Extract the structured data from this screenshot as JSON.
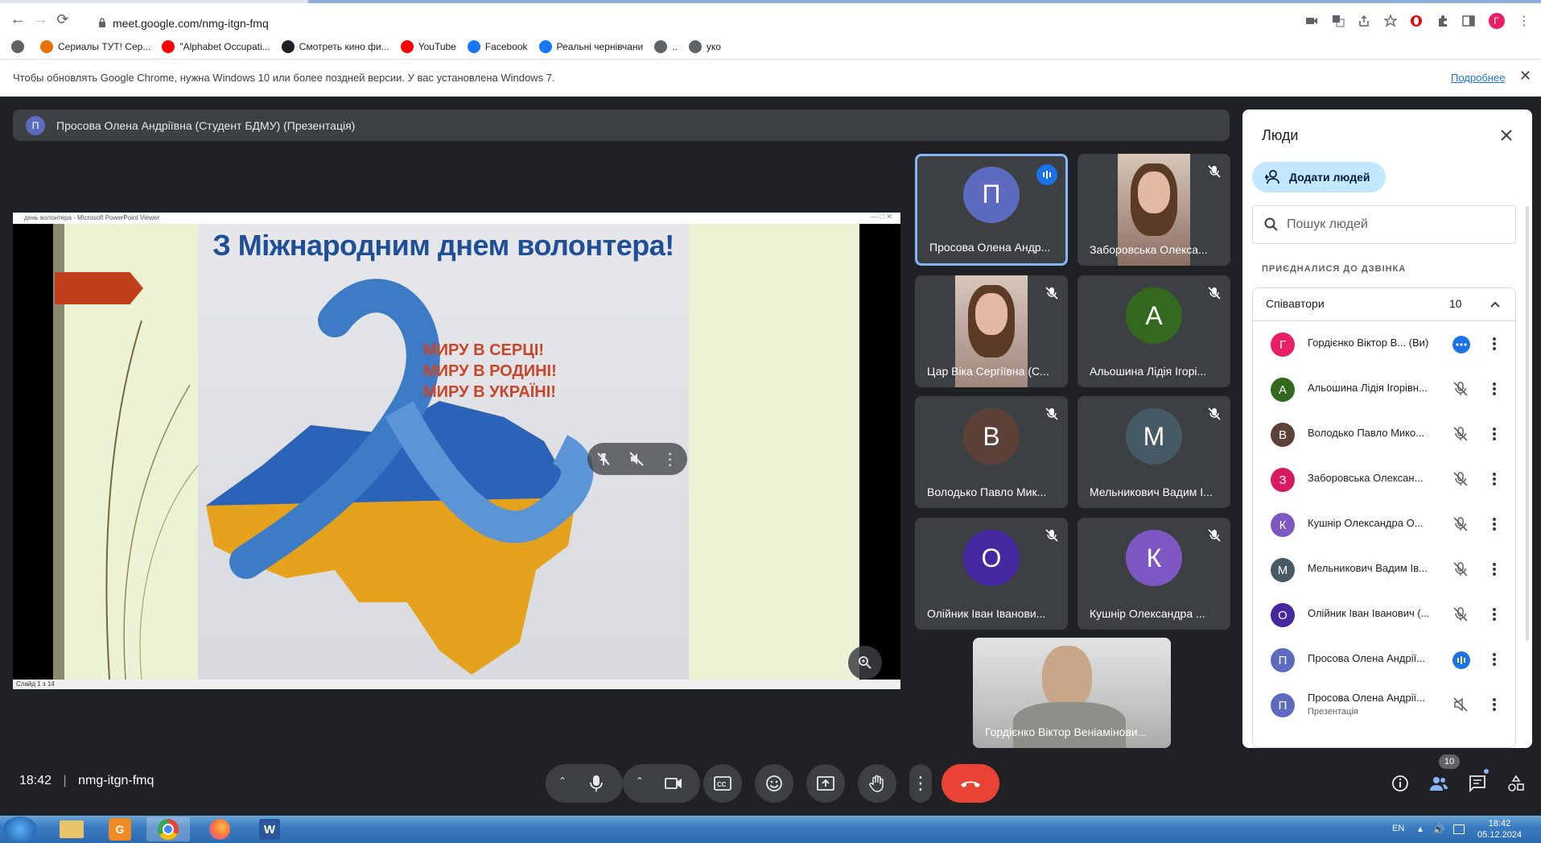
{
  "browser": {
    "url": "meet.google.com/nmg-itgn-fmq",
    "bookmarks": [
      {
        "label": "",
        "color": "#5f6368"
      },
      {
        "label": "Сериалы ТУТ! Сер...",
        "color": "#e8710a"
      },
      {
        "label": "\"Alphabet Occupati...",
        "color": "#ff0000"
      },
      {
        "label": "Смотреть кино фи...",
        "color": "#202124"
      },
      {
        "label": "YouTube",
        "color": "#ff0000"
      },
      {
        "label": "Facebook",
        "color": "#1877f2"
      },
      {
        "label": "Реальні чернівчани",
        "color": "#1877f2"
      },
      {
        "label": "..",
        "color": "#5f6368"
      },
      {
        "label": "уко",
        "color": "#5f6368"
      }
    ],
    "update_message": "Чтобы обновлять Google Chrome, нужна Windows 10 или более поздней версии. У вас установлена Windows 7.",
    "update_link": "Подробнее"
  },
  "banner": {
    "avatar_letter": "П",
    "text": "Просова Олена Андріївна (Студент БДМУ) (Презентація)"
  },
  "slide": {
    "window_title": "день волонтера - Microsoft PowerPoint Viewer",
    "title": "З Міжнародним днем волонтера!",
    "lines": [
      "МИРУ В СЕРЦІ!",
      "МИРУ В РОДИНІ!",
      "МИРУ В УКРАЇНІ!"
    ],
    "status": "Слайд 1 з 14"
  },
  "tiles": [
    {
      "name": "Просова Олена Андр...",
      "letter": "П",
      "color": "#5c6bc0",
      "video": false,
      "speaking": true
    },
    {
      "name": "Заборовська Олекса...",
      "letter": "",
      "color": "#8d6e63",
      "video": true,
      "speaking": false
    },
    {
      "name": "Цар Віка Сергіївна (С...",
      "letter": "",
      "color": "#a1887f",
      "video": true,
      "speaking": false
    },
    {
      "name": "Альошина Лідія Ігорі...",
      "letter": "А",
      "color": "#33691e",
      "video": false,
      "speaking": false
    },
    {
      "name": "Володько Павло Мик...",
      "letter": "В",
      "color": "#5d4037",
      "video": false,
      "speaking": false
    },
    {
      "name": "Мельникович Вадим І...",
      "letter": "М",
      "color": "#455a64",
      "video": false,
      "speaking": false
    },
    {
      "name": "Олійник Іван Іванови...",
      "letter": "О",
      "color": "#4527a0",
      "video": false,
      "speaking": false
    },
    {
      "name": "Кушнір Олександра ...",
      "letter": "К",
      "color": "#7e57c2",
      "video": false,
      "speaking": false
    }
  ],
  "self_tile": {
    "name": "Гордієнко Віктор Веніамінови..."
  },
  "people_panel": {
    "title": "Люди",
    "add_people": "Додати людей",
    "search_placeholder": "Пошук людей",
    "in_call_label": "ПРИЄДНАЛИСЯ ДО ДЗВІНКА",
    "group_label": "Співавтори",
    "group_count": "10",
    "participants": [
      {
        "letter": "Г",
        "color": "#e91e63",
        "name": "Гордієнко Віктор В...  (Ви)",
        "sub": "",
        "mic": "more"
      },
      {
        "letter": "А",
        "color": "#33691e",
        "name": "Альошина Лідія Ігорівн...",
        "sub": "",
        "mic": "muted"
      },
      {
        "letter": "В",
        "color": "#5d4037",
        "name": "Володько Павло Мико...",
        "sub": "",
        "mic": "muted"
      },
      {
        "letter": "З",
        "color": "#d81b60",
        "name": "Заборовська Олексан...",
        "sub": "",
        "mic": "muted"
      },
      {
        "letter": "К",
        "color": "#7e57c2",
        "name": "Кушнір Олександра О...",
        "sub": "",
        "mic": "muted"
      },
      {
        "letter": "М",
        "color": "#455a64",
        "name": "Мельникович Вадим Ів...",
        "sub": "",
        "mic": "muted"
      },
      {
        "letter": "О",
        "color": "#4527a0",
        "name": "Олійник Іван Іванович (...",
        "sub": "",
        "mic": "muted"
      },
      {
        "letter": "П",
        "color": "#5c6bc0",
        "name": "Просова Олена Андрії...",
        "sub": "",
        "mic": "speaking"
      },
      {
        "letter": "П",
        "color": "#5c6bc0",
        "name": "Просова Олена Андрії...",
        "sub": "Презентація",
        "mic": "volume-off"
      }
    ]
  },
  "bottom_bar": {
    "time": "18:42",
    "meeting_code": "nmg-itgn-fmq",
    "people_badge": "10"
  },
  "taskbar": {
    "lang": "EN",
    "time": "18:42",
    "date": "05.12.2024"
  }
}
